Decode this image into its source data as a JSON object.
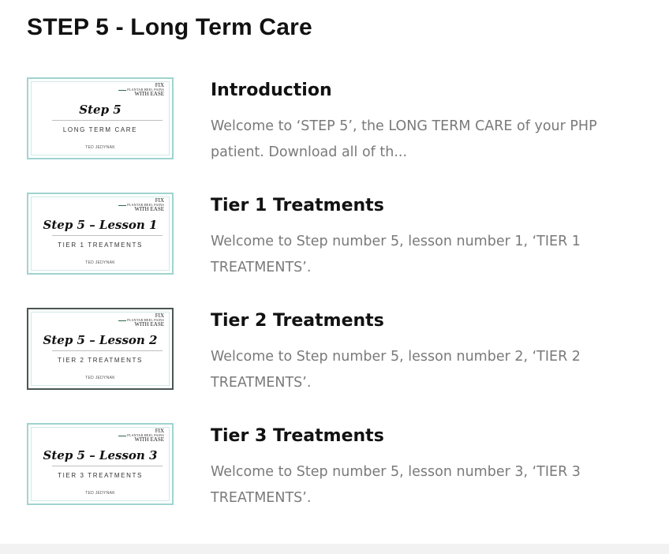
{
  "page": {
    "title": "STEP 5 - Long Term Care"
  },
  "lessons": [
    {
      "title": "Introduction",
      "description": "Welcome to ‘STEP 5’, the LONG TERM CARE of your PHP patient. Download all of th...",
      "thumbnail": {
        "brand_line1": "FIX",
        "brand_line2": "PLANTAR HEEL PAINS",
        "brand_line3": "WITH EASE",
        "heading": "Step 5",
        "subheading": "LONG TERM CARE",
        "author": "TED JEDYNAK",
        "border_color": "#9fd4d0"
      }
    },
    {
      "title": "Tier 1 Treatments",
      "description": "Welcome to Step number 5, lesson number 1, ‘TIER 1 TREATMENTS’.",
      "thumbnail": {
        "brand_line1": "FIX",
        "brand_line2": "PLANTAR HEEL PAINS",
        "brand_line3": "WITH EASE",
        "heading": "Step 5 – Lesson 1",
        "subheading": "TIER 1 TREATMENTS",
        "author": "TED JEDYNAK",
        "border_color": "#9fd4d0"
      }
    },
    {
      "title": "Tier 2 Treatments",
      "description": "Welcome to Step number 5, lesson number 2, ‘TIER 2 TREATMENTS’.",
      "thumbnail": {
        "brand_line1": "FIX",
        "brand_line2": "PLANTAR HEEL PAINS",
        "brand_line3": "WITH EASE",
        "heading": "Step 5 – Lesson 2",
        "subheading": "TIER 2 TREATMENTS",
        "author": "TED JEDYNAK",
        "border_color": "#4a5654"
      }
    },
    {
      "title": "Tier 3 Treatments",
      "description": "Welcome to Step number 5, lesson number 3, ‘TIER 3 TREATMENTS’.",
      "thumbnail": {
        "brand_line1": "FIX",
        "brand_line2": "PLANTAR HEEL PAINS",
        "brand_line3": "WITH EASE",
        "heading": "Step 5 – Lesson 3",
        "subheading": "TIER 3 TREATMENTS",
        "author": "TED JEDYNAK",
        "border_color": "#9fd4d0"
      }
    }
  ],
  "colors": {
    "title_text": "#111111",
    "description_text": "#7a7a7a",
    "thumbnail_accent": "#9fd4d0"
  }
}
